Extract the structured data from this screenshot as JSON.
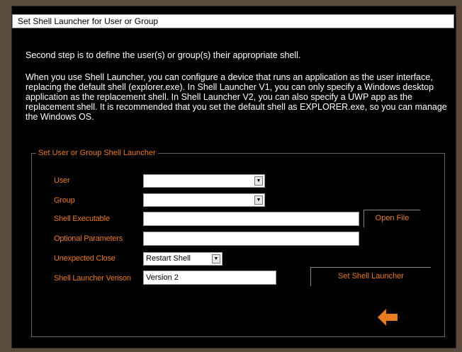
{
  "window": {
    "title": "Set Shell Launcher for User or Group"
  },
  "intro": {
    "step": "Second step is to define the user(s) or group(s) their appropriate shell.",
    "description": "When you use Shell Launcher, you can configure a device that runs an application as the user interface, replacing the default shell (explorer.exe). In Shell Launcher V1, you can only specify a Windows desktop application as the replacement shell. In Shell Launcher V2, you can also specify a UWP app as the replacement shell. It is recommended that you set the default shell as EXPLORER.exe, so you can manage the Windows OS."
  },
  "group": {
    "legend": "Set User or Group Shell Launcher",
    "labels": {
      "user": "User",
      "group": "Group",
      "shell_executable": "Shell Executable",
      "optional_parameters": "Optional Parameters",
      "unexpected_close": "Unexpected Close",
      "version": "Shell Launcher Verison"
    },
    "user_value": "",
    "group_value": "",
    "shell_executable_value": "",
    "optional_parameters_value": "",
    "unexpected_close_value": "Restart Shell",
    "version_value": "Version 2",
    "open_file_label": "Open File",
    "set_label": "Set Shell Launcher"
  },
  "icons": {
    "back": "arrow-left-icon"
  },
  "colors": {
    "accent": "#e97b22",
    "background": "#000000"
  }
}
